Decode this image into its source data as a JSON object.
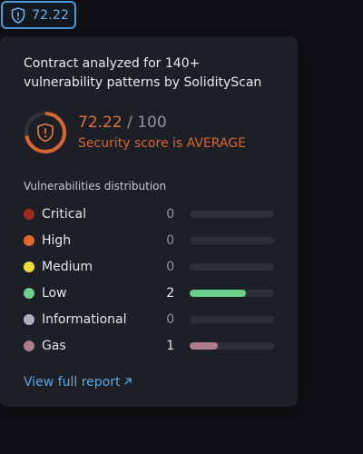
{
  "chip": {
    "value": "72.22",
    "icon": "shield-alert-icon",
    "border_color": "#4a9be0"
  },
  "popover": {
    "description": "Contract analyzed for 140+ vulnerability patterns by SolidityScan",
    "score": {
      "value": "72.22",
      "separator": "/",
      "max": "100",
      "fraction": 0.7222,
      "status": "Security score is AVERAGE",
      "accent": "#d8662f",
      "icon": "shield-alert-icon"
    },
    "distribution": {
      "title": "Vulnerabilities distribution",
      "items": [
        {
          "label": "Critical",
          "count": 0,
          "color": "#9b2a1c",
          "bar_color": "#9b2a1c",
          "fill_fraction": 0
        },
        {
          "label": "High",
          "count": 0,
          "color": "#e8682b",
          "bar_color": "#e8682b",
          "fill_fraction": 0
        },
        {
          "label": "Medium",
          "count": 0,
          "color": "#f2dd3c",
          "bar_color": "#f2dd3c",
          "fill_fraction": 0
        },
        {
          "label": "Low",
          "count": 2,
          "color": "#6bd08a",
          "bar_color": "#6bd08a",
          "fill_fraction": 0.67
        },
        {
          "label": "Informational",
          "count": 0,
          "color": "#aab3c4",
          "bar_color": "#aab3c4",
          "fill_fraction": 0
        },
        {
          "label": "Gas",
          "count": 1,
          "color": "#b07b8c",
          "bar_color": "#b07b8c",
          "fill_fraction": 0.33
        }
      ]
    },
    "link": {
      "label": "View full report",
      "icon": "arrow-up-right-icon"
    }
  }
}
